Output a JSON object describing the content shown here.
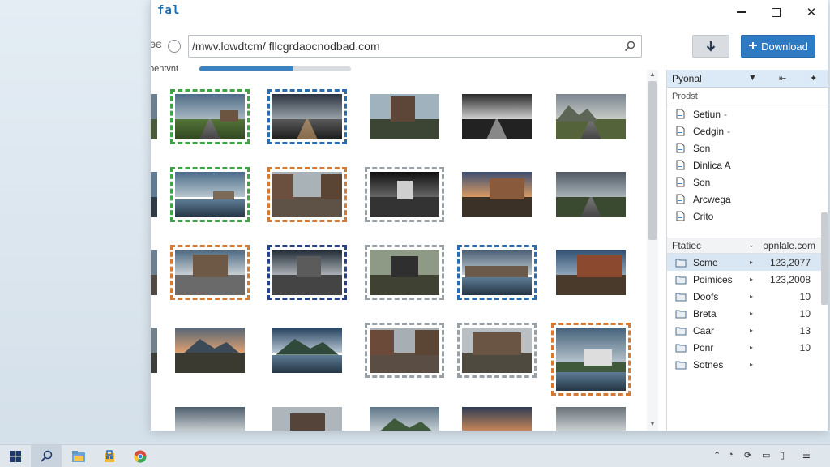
{
  "window": {
    "app_icon_text": "fal",
    "controls": {
      "minimize": "minimize",
      "maximize": "maximize",
      "close": "close"
    }
  },
  "toolbar": {
    "address_prefix": "ЭЄ",
    "url": "/mwv.lowdtcm/ fllcgrdaocnodbad.com",
    "download_label": "Download"
  },
  "progress": {
    "label": "oentvnt",
    "fraction": 0.62
  },
  "sidebar": {
    "header": "Pyonal",
    "subheader": "Prodst",
    "folders": [
      {
        "label": "Setiun",
        "suffix": "-"
      },
      {
        "label": "Cedgin",
        "suffix": "-"
      },
      {
        "label": "Son",
        "suffix": ""
      },
      {
        "label": "Dinlica A",
        "suffix": ""
      },
      {
        "label": "Son",
        "suffix": ""
      },
      {
        "label": "Arcwega",
        "suffix": ""
      },
      {
        "label": "Crito",
        "suffix": ""
      }
    ],
    "section2": {
      "title": "Ftatiec",
      "value": "opnlale.com"
    },
    "files": [
      {
        "label": "Scme",
        "value": "123,2077",
        "selected": true
      },
      {
        "label": "Poimices",
        "value": "123,2008",
        "selected": false
      },
      {
        "label": "Doofs",
        "value": "10",
        "selected": false
      },
      {
        "label": "Breta",
        "value": "10",
        "selected": false
      },
      {
        "label": "Caar",
        "value": "13",
        "selected": false
      },
      {
        "label": "Ponr",
        "value": "10",
        "selected": false
      },
      {
        "label": "Sotnes",
        "value": "",
        "selected": false
      }
    ]
  },
  "colors": {
    "accent": "#2e7bc4",
    "sel_green": "#3ea447",
    "sel_blue": "#2a6db0",
    "sel_orange": "#d47a34"
  }
}
